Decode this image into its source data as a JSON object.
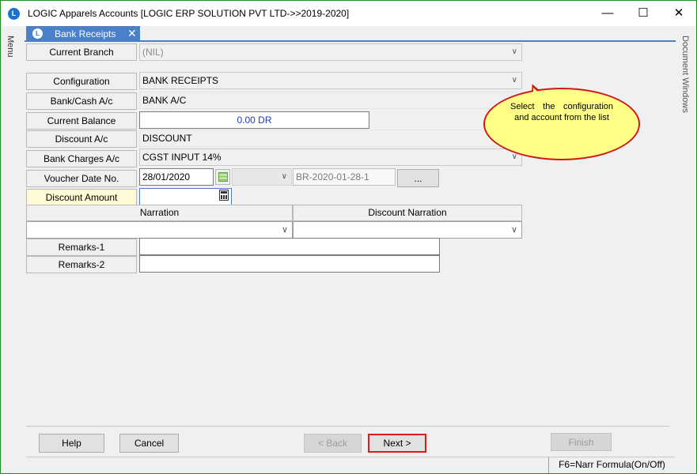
{
  "window": {
    "title": "LOGIC Apparels Accounts  [LOGIC ERP SOLUTION PVT LTD->>2019-2020]",
    "minimize": "—",
    "maximize": "☐",
    "close": "✕",
    "app_icon": "L"
  },
  "left_strip": {
    "label": "Menu"
  },
  "right_strip": {
    "label": "Document Windows"
  },
  "tab": {
    "label": "Bank Receipts",
    "close": "✕",
    "icon": "L"
  },
  "form": {
    "current_branch": {
      "label": "Current Branch",
      "value": "(NIL)"
    },
    "configuration": {
      "label": "Configuration",
      "value": "BANK RECEIPTS"
    },
    "bank_cash": {
      "label": "Bank/Cash A/c",
      "value": "BANK A/C"
    },
    "current_balance": {
      "label": "Current Balance",
      "value": "0.00 DR"
    },
    "discount_ac": {
      "label": "Discount A/c",
      "value": "DISCOUNT"
    },
    "bank_charges": {
      "label": "Bank Charges A/c",
      "value": "CGST INPUT 14%"
    },
    "voucher": {
      "label": "Voucher Date  No.",
      "date": "28/01/2020",
      "number": "BR-2020-01-28-1",
      "more_button": "..."
    },
    "discount_amount": {
      "label": "Discount Amount",
      "value": ""
    },
    "narration": {
      "header": "Narration",
      "value": ""
    },
    "discount_narration": {
      "header": "Discount Narration",
      "value": ""
    },
    "remarks1": {
      "label": "Remarks-1",
      "value": ""
    },
    "remarks2": {
      "label": "Remarks-2",
      "value": ""
    }
  },
  "callout": {
    "text": "Select the configuration and account from the list"
  },
  "buttons": {
    "help": "Help",
    "cancel": "Cancel",
    "back": "< Back",
    "next": "Next >",
    "finish": "Finish"
  },
  "status": {
    "hint": "F6=Narr Formula(On/Off)"
  },
  "icons": {
    "dropdown": "chevron-down-icon",
    "calendar": "calendar-icon",
    "calculator": "calculator-icon"
  },
  "colors": {
    "tab_accent": "#4a7fc9",
    "balance_text": "#1f3bc2",
    "callout_fill": "#ffff88",
    "callout_border": "#d01818",
    "next_border": "#e01818"
  }
}
